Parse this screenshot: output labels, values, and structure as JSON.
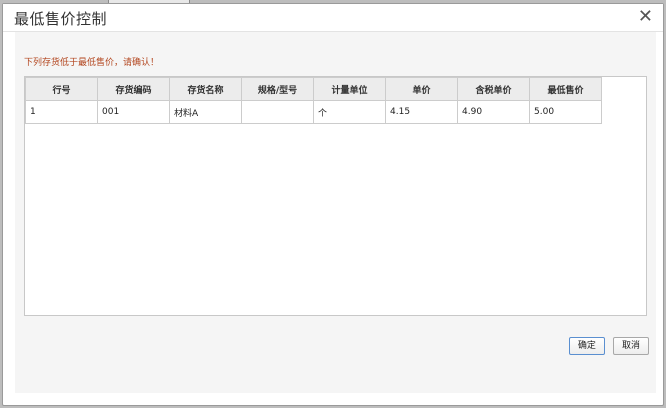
{
  "dialog": {
    "title": "最低售价控制",
    "close_label": "✕"
  },
  "warning_text": "下列存货低于最低售价，请确认！",
  "table": {
    "columns": [
      "行号",
      "存货编码",
      "存货名称",
      "规格/型号",
      "计量单位",
      "单价",
      "含税单价",
      "最低售价"
    ],
    "rows": [
      [
        "1",
        "001",
        "材料A",
        "",
        "个",
        "4.15",
        "4.90",
        "5.00"
      ]
    ]
  },
  "buttons": {
    "confirm_label": "确定",
    "cancel_label": "取消"
  }
}
